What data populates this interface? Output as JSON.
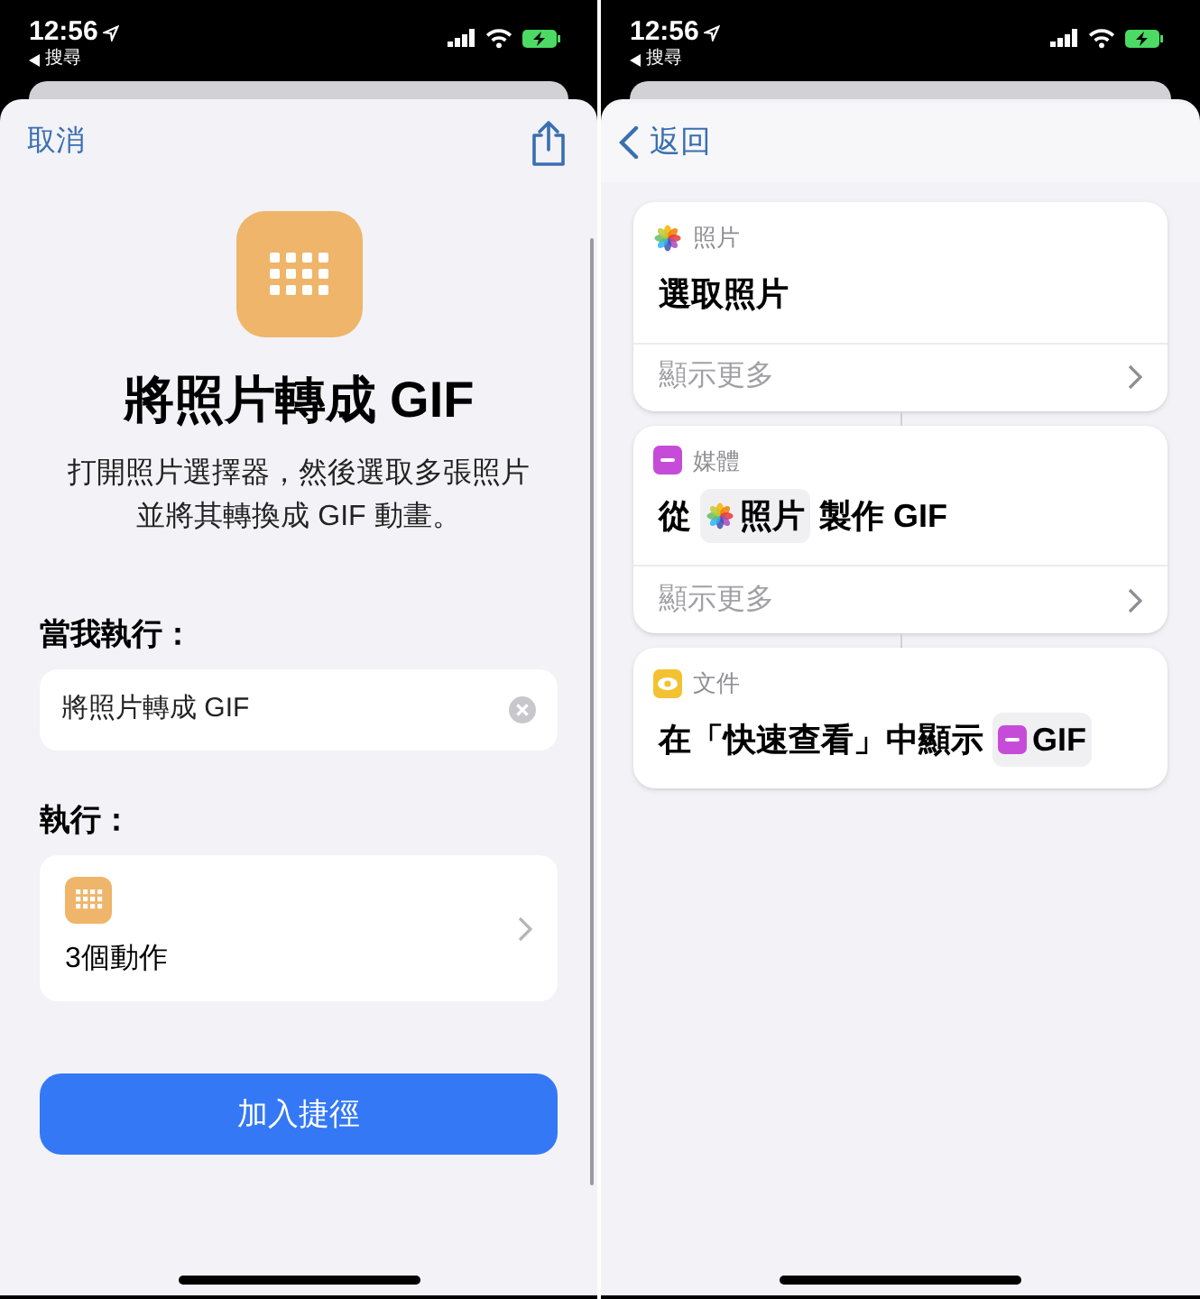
{
  "left_screen": {
    "status_bar": {
      "time": "12:56",
      "back_label": "搜尋"
    },
    "nav": {
      "cancel": "取消"
    },
    "shortcut": {
      "title": "將照片轉成 GIF",
      "description_lines": [
        "打開照片選擇器，然後選取多張照片",
        "並將其轉換成 GIF 動畫。"
      ]
    },
    "when_run": {
      "label": "當我執行：",
      "value": "將照片轉成 GIF"
    },
    "run": {
      "label": "執行：",
      "actions": "3個動作"
    },
    "add_button": "加入捷徑"
  },
  "right_screen": {
    "status_bar": {
      "time": "12:56",
      "back_label": "搜尋"
    },
    "nav": {
      "back": "返回"
    },
    "actions": [
      {
        "kind": "photos",
        "app": "照片",
        "parts": [
          {
            "kind": "text",
            "text": "選取照片"
          }
        ],
        "show_more": "顯示更多"
      },
      {
        "kind": "media",
        "app": "媒體",
        "parts": [
          {
            "kind": "text",
            "text": "從"
          },
          {
            "kind": "photos",
            "text": "照片"
          },
          {
            "kind": "text",
            "text": "製作 GIF"
          }
        ],
        "show_more": "顯示更多"
      },
      {
        "kind": "quicklook",
        "app": "文件",
        "parts": [
          {
            "kind": "text",
            "text": "在「快速查看」中顯示"
          },
          {
            "kind": "media",
            "text": "GIF"
          }
        ]
      }
    ]
  }
}
